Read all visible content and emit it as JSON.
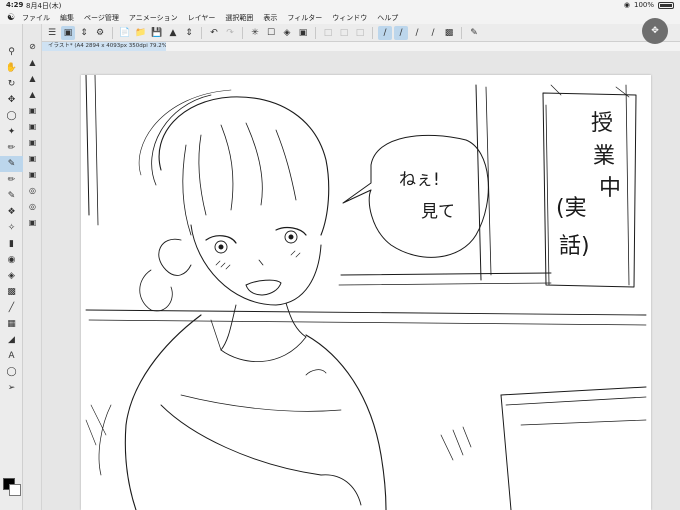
{
  "status_bar": {
    "time": "4:29",
    "date": "8月4日(木)",
    "battery": "100%"
  },
  "menu": {
    "items": [
      "ファイル",
      "編集",
      "ページ管理",
      "アニメーション",
      "レイヤー",
      "選択範囲",
      "表示",
      "フィルター",
      "ウィンドウ",
      "ヘルプ"
    ]
  },
  "document_tab": "イラスト* (A4 2894 x 4093px 350dpi 79.2%)",
  "artwork": {
    "speech_bubble_text": [
      "ねぇ!",
      "見て"
    ],
    "sign_text": [
      "授",
      "業",
      "中",
      "(実",
      "話)"
    ]
  },
  "colors": {
    "accent": "#bcd6ec",
    "main_color": "#000000",
    "sub_color": "#ffffff"
  }
}
